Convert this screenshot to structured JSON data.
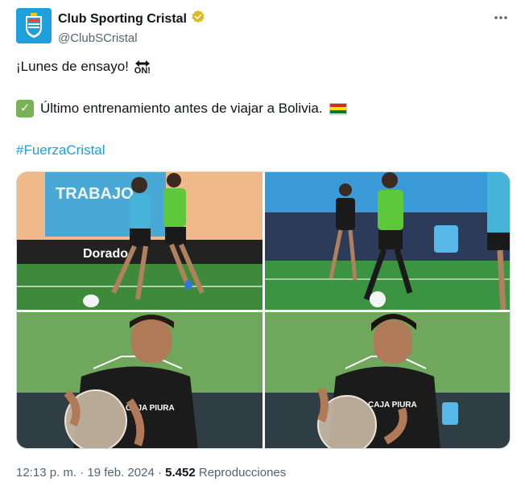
{
  "author": {
    "display_name": "Club Sporting Cristal",
    "handle": "@ClubSCristal",
    "verified_color": "#e2b719",
    "avatar_color": "#1ea0dc"
  },
  "menu_icon": "more-horizontal-icon",
  "post": {
    "line1_text": "¡Lunes de ensayo!",
    "on_badge": "ON!",
    "line2_text": "Último entrenamiento antes de viajar a Bolivia.",
    "hashtag": "#FuerzaCristal"
  },
  "photos": {
    "p1_banner": "TRABAJO",
    "p1_board": "Dorado",
    "p3_shirt": "CAJA PIURA",
    "p4_shirt": "CAJA PIURA"
  },
  "meta": {
    "time": "12:13 p. m.",
    "separator1": " · ",
    "date": "19 feb. 2024",
    "separator2": " · ",
    "views": "5.452",
    "views_label": "Reproducciones"
  },
  "colors": {
    "link": "#1d9bf0",
    "muted": "#536471",
    "check_green": "#77b255"
  }
}
